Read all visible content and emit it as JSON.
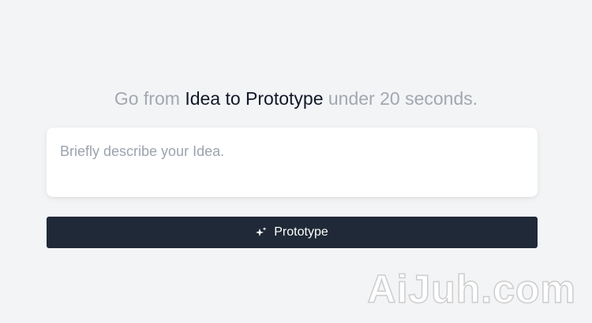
{
  "headline": {
    "prefix": "Go from ",
    "highlight": "Idea to Prototype",
    "suffix": " under 20 seconds."
  },
  "idea_input": {
    "placeholder": "Briefly describe your Idea.",
    "value": ""
  },
  "prototype_button": {
    "label": "Prototype",
    "icon": "sparkles-icon"
  },
  "watermark": {
    "text": "AiJuh.com"
  },
  "colors": {
    "background": "#f3f4f6",
    "muted_text": "#a3a7b0",
    "strong_text": "#111827",
    "button_bg": "#1f2937",
    "button_text": "#ffffff"
  }
}
